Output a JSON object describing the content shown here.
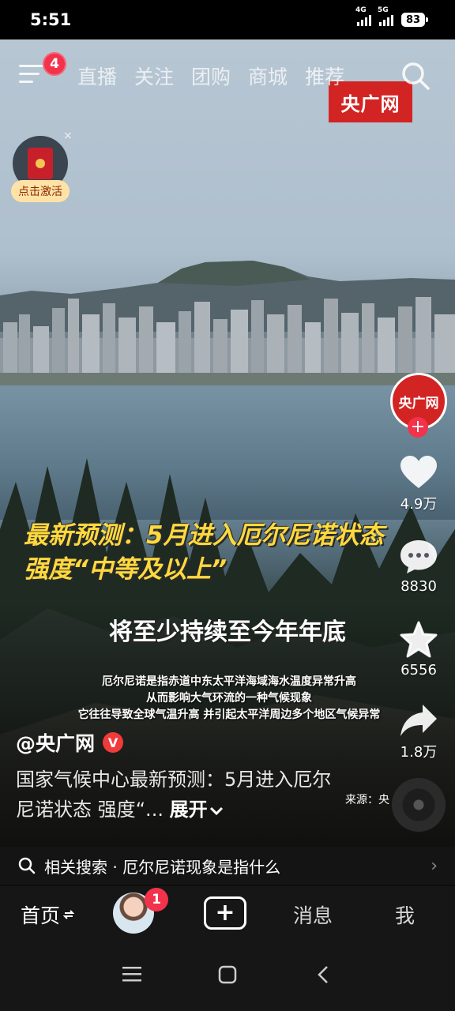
{
  "status_bar": {
    "time": "5:51",
    "network_1": "4G",
    "network_2": "5G",
    "battery": "83"
  },
  "top_nav": {
    "menu_badge": "4",
    "tabs": [
      {
        "label": "直播"
      },
      {
        "label": "关注"
      },
      {
        "label": "团购"
      },
      {
        "label": "商城"
      },
      {
        "label": "推荐"
      }
    ],
    "active_tab": "推荐"
  },
  "watermark": "央广网",
  "red_packet": {
    "label": "点击激活",
    "close": "×"
  },
  "video_text": {
    "headline_line1": "最新预测：5月进入厄尔尼诺状态",
    "headline_line2": "强度“中等及以上”",
    "subheadline": "将至少持续至今年年底",
    "caption_lines": [
      "厄尔尼诺是指赤道中东太平洋海域海水温度异常升高",
      "从而影响大气环流的一种气候现象",
      "它往往导致全球气温升高 并引起太平洋周边多个地区气候异常"
    ]
  },
  "rail": {
    "avatar_text": "央广网",
    "follow_symbol": "+",
    "like_count": "4.9万",
    "comment_count": "8830",
    "favorite_count": "6556",
    "share_count": "1.8万"
  },
  "post": {
    "author": "@央广网",
    "verified_symbol": "V",
    "description": "国家气候中心最新预测：5月进入厄尔尼诺状态 强度“...",
    "expand_label": "展开",
    "source": "来源：央"
  },
  "related_search": {
    "label": "相关搜索 · 厄尔尼诺现象是指什么",
    "chevron": "›"
  },
  "bottom_nav": {
    "home": "首页",
    "friends_badge": "1",
    "create": "+",
    "messages": "消息",
    "me": "我"
  },
  "colors": {
    "accent_red": "#f2334b",
    "headline_yellow": "#ffd93d",
    "brand_red": "#d32424"
  }
}
